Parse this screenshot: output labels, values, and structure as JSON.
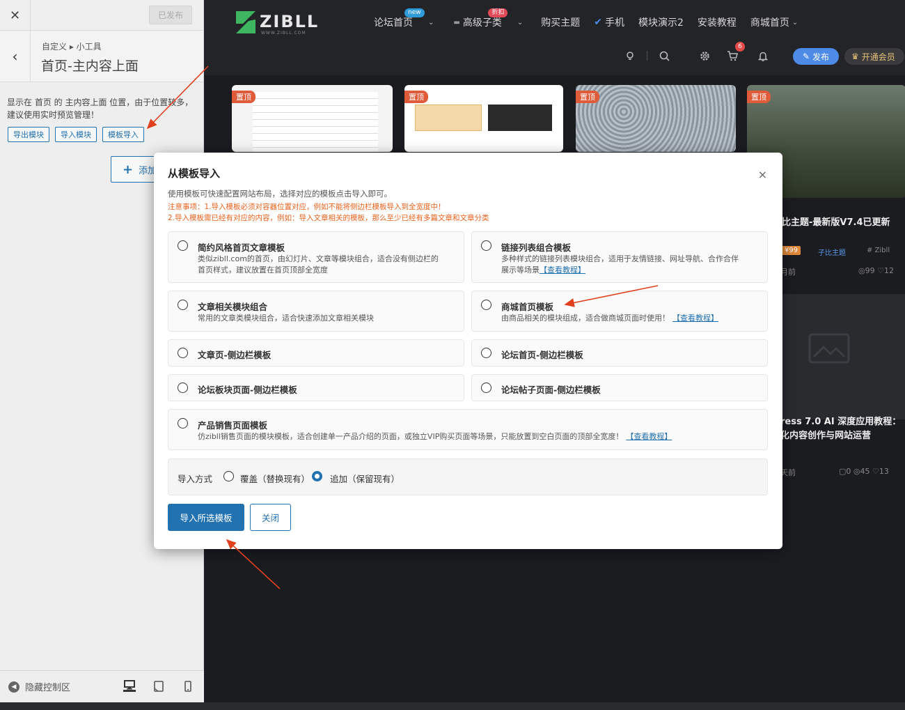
{
  "customizer": {
    "close_glyph": "✕",
    "publish_label": "已发布",
    "back_glyph": "‹",
    "breadcrumb": "自定义 ▸ 小工具",
    "section_title": "首页-主内容上面",
    "description": "显示在 首页 的 主内容上面 位置，由于位置较多，建议使用实时预览管理！",
    "buttons": [
      "导出模块",
      "导入模块",
      "模板导入"
    ],
    "add_label": "添加",
    "hide_controls": "隐藏控制区"
  },
  "site": {
    "logo_text": "ZIBLL",
    "logo_sub": "WWW.ZIBLL.COM",
    "nav": [
      {
        "label": "论坛首页",
        "badge": "new"
      },
      {
        "label": "高级子类",
        "badge": "折扣"
      },
      {
        "label": "购买主题"
      },
      {
        "label": "手机"
      },
      {
        "label": "模块演示2"
      },
      {
        "label": "安装教程"
      },
      {
        "label": "商城首页"
      }
    ],
    "cart_count": "6",
    "publish_btn": "发布",
    "vip_btn": "开通会员",
    "pin_label": "置顶",
    "right_title": "比主题-最新版V7.4已更新",
    "right_tag1": "¥99",
    "right_tag2": "子比主题",
    "right_tag3": "# Zibll",
    "right_meta_left": "月前",
    "right_meta_right": "◎99 ♡12",
    "right_title2_line1": "ress 7.0 AI 深度应用教程：",
    "right_title2_line2": "化内容创作与网站运营",
    "right_meta2_left": "天前",
    "right_meta2_right": "▢0 ◎45 ♡13"
  },
  "modal": {
    "title": "从模板导入",
    "close_glyph": "×",
    "description": "使用模板可快速配置网站布局，选择对应的模板点击导入即可。",
    "note1": "注意事项：1.导入模板必须对容器位置对应，例如不能将侧边栏模板导入到全宽度中！",
    "note2": "2.导入模板需已经有对应的内容，例如：导入文章相关的模板，那么至少已经有多篇文章和文章分类",
    "link_text": "【查看教程】",
    "options": {
      "simple_home": {
        "title": "简约风格首页文章模板",
        "desc1": "类似zibll.com的首页，由幻灯片、文章等模块组合，适合没有侧边栏的",
        "desc2": "首页样式，建议放置在首页顶部全宽度"
      },
      "link_list": {
        "title": "链接列表组合模板",
        "desc1": "多种样式的链接列表模块组合，适用于友情链接、网址导航、合作合伴",
        "desc2": "展示等场景"
      },
      "article_combo": {
        "title": "文章相关模块组合",
        "desc1": "常用的文章类模块组合，适合快速添加文章相关模块"
      },
      "shop_home": {
        "title": "商城首页模板",
        "desc1": "由商品相关的模块组成，适合做商城页面时使用！"
      },
      "post_sidebar": {
        "title": "文章页-侧边栏模板"
      },
      "forum_home_sidebar": {
        "title": "论坛首页-侧边栏模板"
      },
      "forum_board_sidebar": {
        "title": "论坛板块页面-侧边栏模板"
      },
      "forum_post_sidebar": {
        "title": "论坛帖子页面-侧边栏模板"
      },
      "product_sales": {
        "title": "产品销售页面模板",
        "desc1": "仿zibll销售页面的模块模板，适合创建单一产品介绍的页面，或独立VIP购买页面等场景，只能放置到空白页面的顶部全宽度！"
      }
    },
    "import_mode": {
      "label": "导入方式",
      "overwrite": "覆盖（替换现有）",
      "append": "追加（保留现有）",
      "selected": "append"
    },
    "import_btn": "导入所选模板",
    "close_btn": "关闭"
  },
  "colors": {
    "accent": "#2271b1",
    "warning": "#e8621c",
    "arrow": "#e0401e"
  }
}
